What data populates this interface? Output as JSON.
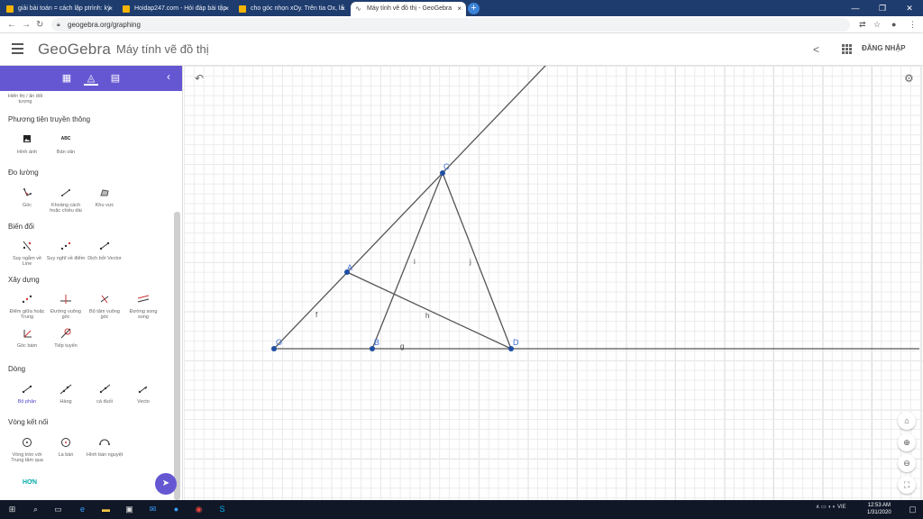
{
  "browser": {
    "tabs": [
      {
        "title": "giải bài toán = cách lập ptrình: kỳ"
      },
      {
        "title": "Hoidap247.com - Hỏi đáp bài tập"
      },
      {
        "title": "cho góc nhọn xOy. Trên tia Ox, lấ"
      },
      {
        "title": "Máy tính vẽ đồ thị - GeoGebra"
      }
    ],
    "new_tab": "+",
    "url": "geogebra.org/graphing"
  },
  "app": {
    "logo": "GeoGebra",
    "title": "Máy tính vẽ đồ thị",
    "login": "ĐĂNG NHẬP"
  },
  "tools": {
    "top_partial": "Hiển thị / ẩn đối tượng",
    "sections": [
      {
        "title": "Phương tiện truyền thông",
        "items": [
          "Hình ảnh",
          "Bản văn"
        ]
      },
      {
        "title": "Đo lường",
        "items": [
          "Góc",
          "Khoảng cách hoặc chiều dài",
          "Khu vực"
        ]
      },
      {
        "title": "Biến đổi",
        "items": [
          "Suy ngẫm về Line",
          "Suy nghĩ về điểm",
          "Dịch bởi Vector"
        ]
      },
      {
        "title": "Xây dựng",
        "items": [
          "Điểm giữa hoặc Trung",
          "Đường vuông góc",
          "Bộ tâm vuông góc",
          "Đường song song",
          "Góc bám",
          "Tiếp tuyến"
        ]
      },
      {
        "title": "Dòng",
        "items": [
          "Bộ phận",
          "Hàng",
          "cá đuối",
          "Vecto"
        ]
      },
      {
        "title": "Vòng kết nối",
        "items": [
          "Vòng tròn với Trung tâm qua",
          "La bàn",
          "Hình bán nguyệt"
        ]
      }
    ],
    "more": "HƠN",
    "abc_icon": "ABC"
  },
  "geometry": {
    "points": [
      "O",
      "B",
      "D",
      "A",
      "C"
    ],
    "segment_labels": [
      "f",
      "g",
      "h",
      "i",
      "j"
    ]
  },
  "taskbar": {
    "time": "12:53 AM",
    "date": "1/31/2020",
    "lang": "VIE"
  },
  "colors": {
    "tab_bar": "#1f3c6e",
    "panel_header": "#6557d2",
    "point": "#1f4fa3",
    "point_label": "#3d6fd6",
    "segment": "#555555",
    "taskbar": "#101828"
  }
}
